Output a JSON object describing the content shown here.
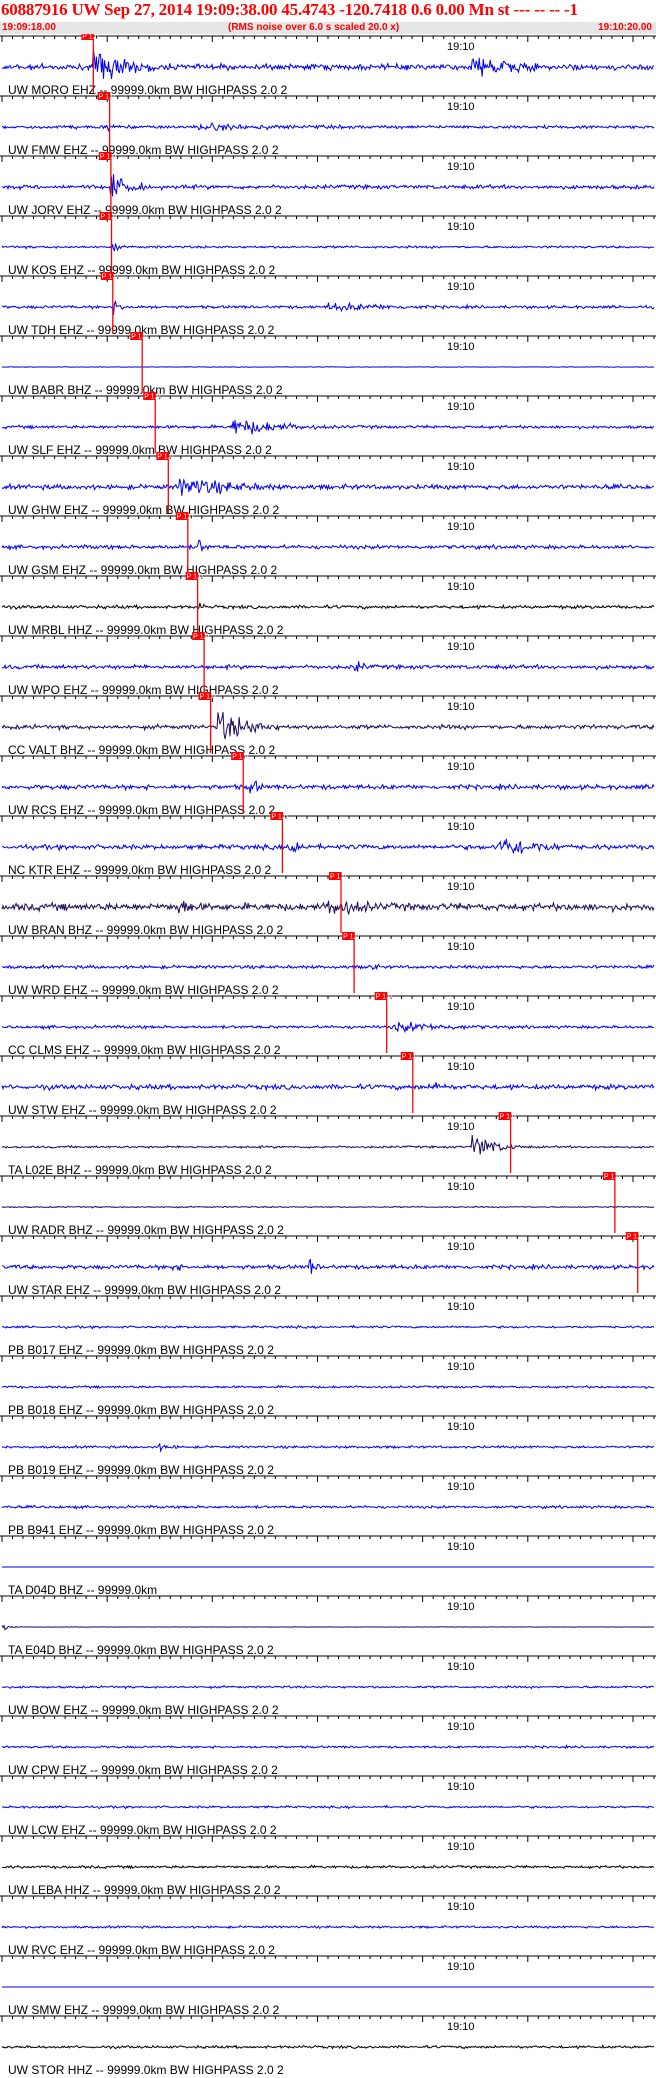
{
  "header": {
    "title": "60887916 UW Sep 27, 2014 19:09:38.00   45.4743 -120.7418  0.6 0.00 Mn st --- -- --  -1",
    "time_start": "19:09:18.00",
    "rms_note": "(RMS noise over 6.0 s scaled 20.0 x)",
    "time_end": "19:10:20.00"
  },
  "colors": {
    "trace_primary": "#0000ee",
    "trace_dark": "#1c0a5a",
    "trace_black": "#000000",
    "pick": "#ff0000",
    "subtitle_band": "#e6e6e6"
  },
  "chart_data": {
    "type": "seismogram",
    "x_unit": "time (UTC)",
    "x_range": [
      "19:09:18.00",
      "19:10:20.00"
    ],
    "center_tick_label": "19:10",
    "pick_label": "P 1.0",
    "traces": [
      {
        "label": "UW MORO EHZ -- 99999.0km BW  HIGHPASS  2.0  2",
        "amp": 2.2,
        "noise": 0.35,
        "color": "#0000ee",
        "pick": 0.14,
        "bursts": [
          [
            0.14,
            0.35,
            1.0
          ],
          [
            0.72,
            0.95,
            0.85
          ]
        ]
      },
      {
        "label": "UW FMW EHZ -- 99999.0km BW  HIGHPASS  2.0  2",
        "amp": 1.0,
        "noise": 0.45,
        "color": "#0000ee",
        "pick": 0.165,
        "bursts": [
          [
            0.16,
            0.19,
            1.0
          ],
          [
            0.3,
            0.98,
            0.5
          ]
        ]
      },
      {
        "label": "UW JORV EHZ -- 99999.0km BW  HIGHPASS  2.0  2",
        "amp": 1.8,
        "noise": 0.3,
        "color": "#0000ee",
        "pick": 0.167,
        "bursts": [
          [
            0.165,
            0.28,
            1.0
          ]
        ]
      },
      {
        "label": "UW KOS EHZ -- 99999.0km BW  HIGHPASS  2.0  2",
        "amp": 1.6,
        "noise": 0.2,
        "color": "#0000ee",
        "pick": 0.168,
        "bursts": [
          [
            0.168,
            0.19,
            1.0
          ]
        ]
      },
      {
        "label": "UW TDH EHZ -- 99999.0km BW  HIGHPASS  2.0  2",
        "amp": 1.0,
        "noise": 0.4,
        "color": "#0000ee",
        "pick": 0.17,
        "bursts": [
          [
            0.17,
            0.25,
            0.9
          ],
          [
            0.5,
            0.99,
            0.6
          ]
        ]
      },
      {
        "label": "UW BABR BHZ -- 99999.0km BW  HIGHPASS  2.0  2",
        "amp": 0.4,
        "noise": 0.2,
        "color": "#0000ee",
        "pick": 0.215,
        "bursts": []
      },
      {
        "label": "UW SLF EHZ -- 99999.0km BW  HIGHPASS  2.0  2",
        "amp": 1.4,
        "noise": 0.3,
        "color": "#0000ee",
        "pick": 0.235,
        "bursts": [
          [
            0.35,
            0.62,
            0.9
          ]
        ]
      },
      {
        "label": "UW GHW EHZ -- 99999.0km BW  HIGHPASS  2.0  2",
        "amp": 1.8,
        "noise": 0.35,
        "color": "#0000ee",
        "pick": 0.255,
        "bursts": [
          [
            0.27,
            0.6,
            0.8
          ]
        ]
      },
      {
        "label": "UW GSM EHZ -- 99999.0km BW  HIGHPASS  2.0  2",
        "amp": 1.3,
        "noise": 0.4,
        "color": "#0000ee",
        "pick": 0.285,
        "bursts": [
          [
            0.3,
            0.34,
            1.0
          ]
        ]
      },
      {
        "label": "UW MRBL HHZ -- 99999.0km BW  HIGHPASS  2.0  2",
        "amp": 0.9,
        "noise": 0.5,
        "color": "#000000",
        "pick": 0.3,
        "bursts": [
          [
            0.3,
            0.33,
            1.0
          ]
        ]
      },
      {
        "label": "UW WPO EHZ -- 99999.0km BW  HIGHPASS  2.0  2",
        "amp": 1.1,
        "noise": 0.5,
        "color": "#0000ee",
        "pick": 0.31,
        "bursts": [
          [
            0.54,
            0.6,
            0.9
          ]
        ]
      },
      {
        "label": "CC VALT BHZ -- 99999.0km BW  HIGHPASS  2.0  2",
        "amp": 2.3,
        "noise": 0.25,
        "color": "#1c0a5a",
        "pick": 0.32,
        "bursts": [
          [
            0.33,
            0.5,
            1.0
          ]
        ]
      },
      {
        "label": "UW RCS EHZ -- 99999.0km BW  HIGHPASS  2.0  2",
        "amp": 1.4,
        "noise": 0.45,
        "color": "#0000ee",
        "pick": 0.37,
        "bursts": [
          [
            0.38,
            0.43,
            1.0
          ]
        ]
      },
      {
        "label": "NC KTR EHZ -- 99999.0km BW  HIGHPASS  2.0  2",
        "amp": 1.8,
        "noise": 0.35,
        "color": "#0000ee",
        "pick": 0.43,
        "bursts": [
          [
            0.44,
            0.5,
            1.0
          ],
          [
            0.76,
            0.99,
            0.9
          ]
        ]
      },
      {
        "label": "UW BRAN BHZ -- 99999.0km BW  HIGHPASS  2.0  2",
        "amp": 1.8,
        "noise": 0.55,
        "color": "#1c0a5a",
        "pick": 0.52,
        "bursts": [
          [
            0.27,
            0.36,
            0.8
          ],
          [
            0.5,
            0.72,
            0.8
          ]
        ]
      },
      {
        "label": "UW WRD EHZ -- 99999.0km BW  HIGHPASS  2.0  2",
        "amp": 1.1,
        "noise": 0.4,
        "color": "#0000ee",
        "pick": 0.54,
        "bursts": [
          [
            0.56,
            0.6,
            0.9
          ]
        ]
      },
      {
        "label": "CC CLMS EHZ -- 99999.0km BW  HIGHPASS  2.0  2",
        "amp": 0.9,
        "noise": 0.45,
        "color": "#0000ee",
        "pick": 0.59,
        "bursts": [
          [
            0.6,
            0.99,
            0.8
          ]
        ]
      },
      {
        "label": "UW STW EHZ -- 99999.0km BW  HIGHPASS  2.0  2",
        "amp": 1.2,
        "noise": 0.55,
        "color": "#0000ee",
        "pick": 0.63,
        "bursts": [
          [
            0.66,
            0.72,
            1.0
          ]
        ]
      },
      {
        "label": "TA L02E BHZ -- 99999.0km BW  HIGHPASS  2.0  2",
        "amp": 2.0,
        "noise": 0.15,
        "color": "#1c0a5a",
        "pick": 0.78,
        "bursts": [
          [
            0.72,
            0.83,
            1.0
          ]
        ]
      },
      {
        "label": "UW RADR BHZ -- 99999.0km BW  HIGHPASS  2.0  2",
        "amp": 0.5,
        "noise": 0.35,
        "color": "#1c0a5a",
        "pick": 0.94,
        "bursts": []
      },
      {
        "label": "UW STAR EHZ -- 99999.0km BW  HIGHPASS  2.0  2",
        "amp": 1.4,
        "noise": 0.4,
        "color": "#0000ee",
        "pick": 0.975,
        "bursts": [
          [
            0.26,
            0.3,
            0.8
          ],
          [
            0.47,
            0.51,
            1.0
          ]
        ]
      },
      {
        "label": "PB B017 EHZ -- 99999.0km BW  HIGHPASS  2.0  2",
        "amp": 0.5,
        "noise": 0.6,
        "color": "#0000ee",
        "pick": null,
        "bursts": []
      },
      {
        "label": "PB B018 EHZ -- 99999.0km BW  HIGHPASS  2.0  2",
        "amp": 0.5,
        "noise": 0.6,
        "color": "#0000ee",
        "pick": null,
        "bursts": []
      },
      {
        "label": "PB B019 EHZ -- 99999.0km BW  HIGHPASS  2.0  2",
        "amp": 0.6,
        "noise": 0.55,
        "color": "#0000ee",
        "pick": null,
        "bursts": [
          [
            0.24,
            0.34,
            0.8
          ]
        ]
      },
      {
        "label": "PB B941 EHZ -- 99999.0km BW  HIGHPASS  2.0  2",
        "amp": 0.6,
        "noise": 0.6,
        "color": "#0000ee",
        "pick": null,
        "bursts": []
      },
      {
        "label": "TA D04D BHZ -- 99999.0km",
        "amp": 0.0,
        "noise": 0.0,
        "color": "#0000ee",
        "pick": null,
        "bursts": []
      },
      {
        "label": "TA E04D BHZ -- 99999.0km BW  HIGHPASS  2.0  2",
        "amp": 0.5,
        "noise": 0.1,
        "color": "#1c0a5a",
        "pick": null,
        "bursts": [
          [
            0.0,
            0.04,
            1.0
          ]
        ]
      },
      {
        "label": "UW BOW EHZ -- 99999.0km BW  HIGHPASS  2.0  2",
        "amp": 0.5,
        "noise": 0.6,
        "color": "#0000ee",
        "pick": null,
        "bursts": []
      },
      {
        "label": "UW CPW EHZ -- 99999.0km BW  HIGHPASS  2.0  2",
        "amp": 0.5,
        "noise": 0.6,
        "color": "#0000ee",
        "pick": null,
        "bursts": []
      },
      {
        "label": "UW LCW EHZ -- 99999.0km BW  HIGHPASS  2.0  2",
        "amp": 0.5,
        "noise": 0.6,
        "color": "#0000ee",
        "pick": null,
        "bursts": []
      },
      {
        "label": "UW LEBA HHZ -- 99999.0km BW  HIGHPASS  2.0  2",
        "amp": 0.6,
        "noise": 0.6,
        "color": "#000000",
        "pick": null,
        "bursts": []
      },
      {
        "label": "UW RVC EHZ -- 99999.0km BW  HIGHPASS  2.0  2",
        "amp": 0.5,
        "noise": 0.6,
        "color": "#0000ee",
        "pick": null,
        "bursts": []
      },
      {
        "label": "UW SMW EHZ -- 99999.0km BW  HIGHPASS  2.0  2",
        "amp": 0.0,
        "noise": 0.0,
        "color": "#0000ee",
        "pick": null,
        "bursts": [],
        "flat": true
      },
      {
        "label": "UW STOR HHZ -- 99999.0km BW  HIGHPASS  2.0  2",
        "amp": 0.6,
        "noise": 0.6,
        "color": "#000000",
        "pick": null,
        "bursts": []
      }
    ]
  }
}
